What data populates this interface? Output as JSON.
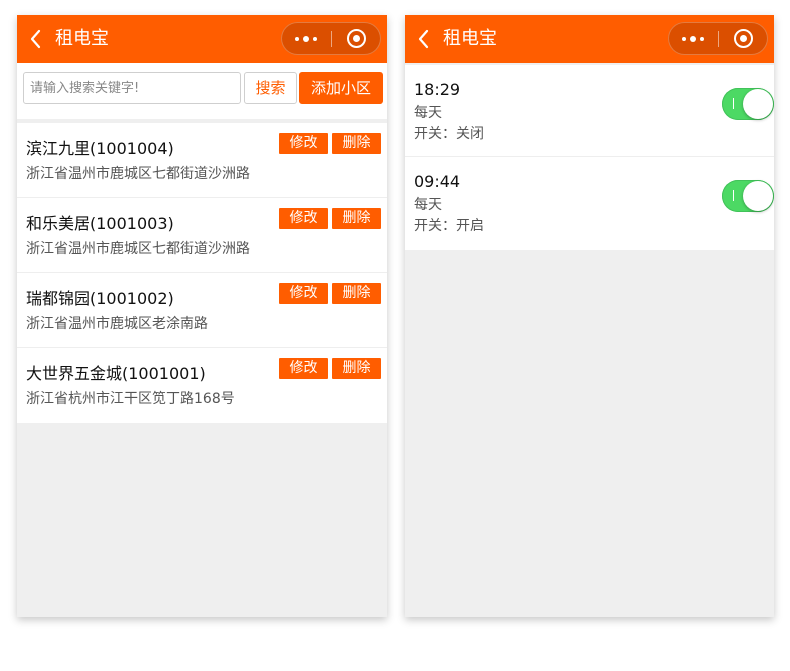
{
  "colors": {
    "accent": "#ff5d00",
    "switch_on": "#4cd964",
    "background": "#efefef"
  },
  "left": {
    "navbar": {
      "title": "租电宝",
      "back_icon": "chevron-left-icon",
      "more_icon": "more-dots-icon",
      "close_icon": "target-ring-icon"
    },
    "search": {
      "placeholder": "请输入搜索关键字!",
      "search_label": "搜索",
      "add_label": "添加小区"
    },
    "communities": [
      {
        "name": "滨江九里(1001004)",
        "address": "浙江省温州市鹿城区七都街道沙洲路",
        "edit_label": "修改",
        "delete_label": "删除"
      },
      {
        "name": "和乐美居(1001003)",
        "address": "浙江省温州市鹿城区七都街道沙洲路",
        "edit_label": "修改",
        "delete_label": "删除"
      },
      {
        "name": "瑞都锦园(1001002)",
        "address": "浙江省温州市鹿城区老涂南路",
        "edit_label": "修改",
        "delete_label": "删除"
      },
      {
        "name": "大世界五金城(1001001)",
        "address": "浙江省杭州市江干区笕丁路168号",
        "edit_label": "修改",
        "delete_label": "删除"
      }
    ]
  },
  "right": {
    "navbar": {
      "title": "租电宝",
      "back_icon": "chevron-left-icon",
      "more_icon": "more-dots-icon",
      "close_icon": "target-ring-icon"
    },
    "timers": [
      {
        "time": "18:29",
        "repeat": "每天",
        "status": "开关：关闭",
        "enabled": true
      },
      {
        "time": "09:44",
        "repeat": "每天",
        "status": "开关：开启",
        "enabled": true
      }
    ]
  }
}
